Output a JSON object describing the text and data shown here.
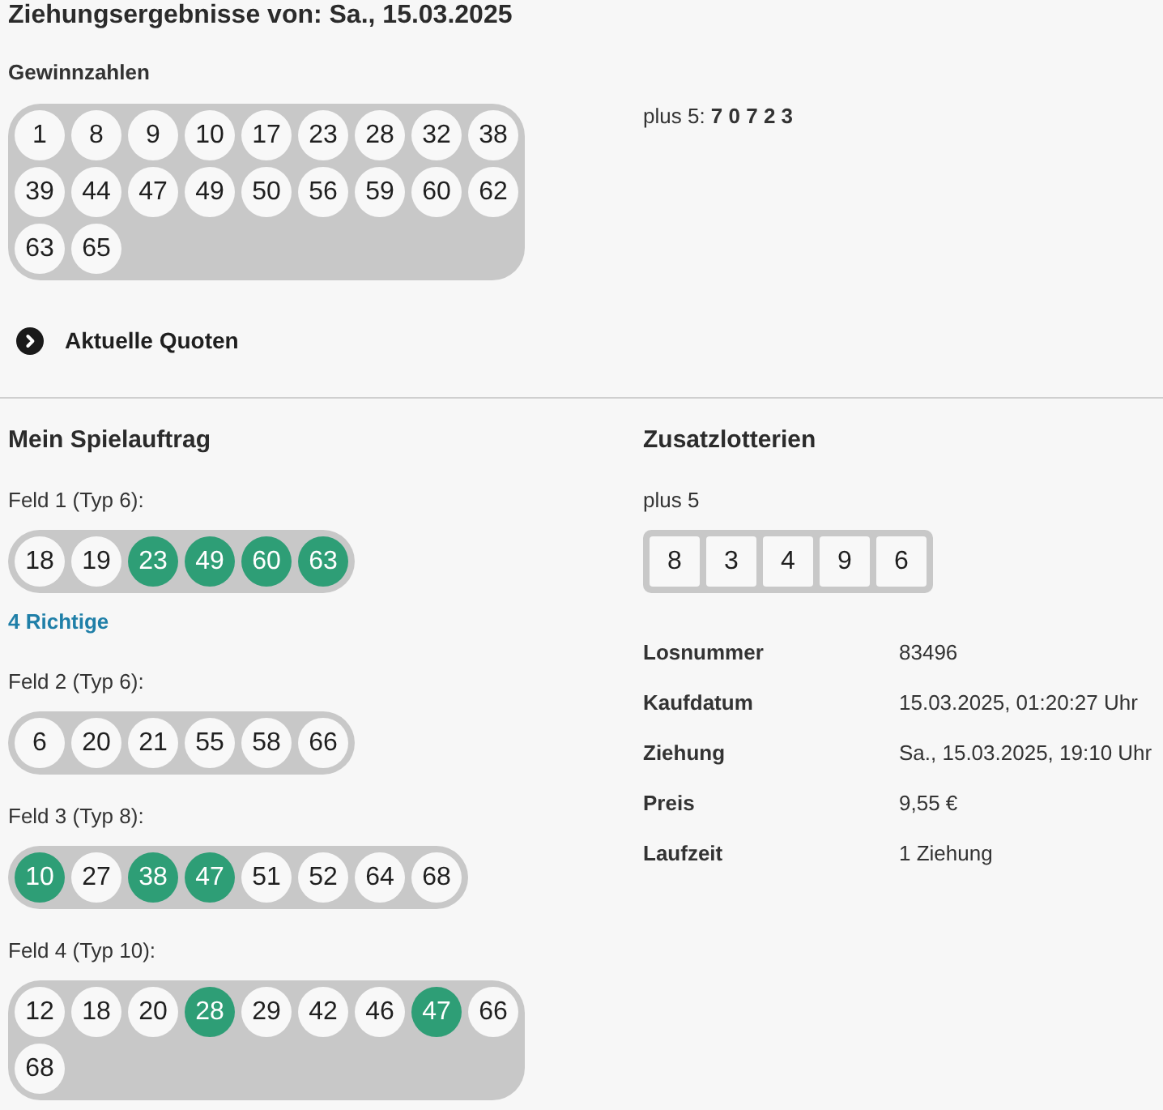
{
  "draw": {
    "title": "Ziehungsergebnisse von: Sa., 15.03.2025",
    "numbers_label": "Gewinnzahlen",
    "numbers": [
      "1",
      "8",
      "9",
      "10",
      "17",
      "23",
      "28",
      "32",
      "38",
      "39",
      "44",
      "47",
      "49",
      "50",
      "56",
      "59",
      "60",
      "62",
      "63",
      "65"
    ],
    "plus5_result": "plus 5: **7 0 7 2 3**"
  },
  "quotes_link": {
    "label": "Aktuelle Quoten",
    "expanded": false
  },
  "my_ticket": {
    "heading": "Mein Spielauftrag",
    "fields": [
      {
        "label": "Feld 1 (Typ 6):",
        "numbers": [
          {
            "value": "18",
            "hit": false
          },
          {
            "value": "19",
            "hit": false
          },
          {
            "value": "23",
            "hit": true
          },
          {
            "value": "49",
            "hit": true
          },
          {
            "value": "60",
            "hit": true
          },
          {
            "value": "63",
            "hit": true
          }
        ],
        "result": "4 Richtige"
      },
      {
        "label": "Feld 2 (Typ 6):",
        "numbers": [
          {
            "value": "6",
            "hit": false
          },
          {
            "value": "20",
            "hit": false
          },
          {
            "value": "21",
            "hit": false
          },
          {
            "value": "55",
            "hit": false
          },
          {
            "value": "58",
            "hit": false
          },
          {
            "value": "66",
            "hit": false
          }
        ]
      },
      {
        "label": "Feld 3 (Typ 8):",
        "numbers": [
          {
            "value": "10",
            "hit": true
          },
          {
            "value": "27",
            "hit": false
          },
          {
            "value": "38",
            "hit": true
          },
          {
            "value": "47",
            "hit": true
          },
          {
            "value": "51",
            "hit": false
          },
          {
            "value": "52",
            "hit": false
          },
          {
            "value": "64",
            "hit": false
          },
          {
            "value": "68",
            "hit": false
          }
        ]
      },
      {
        "label": "Feld 4 (Typ 10):",
        "numbers": [
          {
            "value": "12",
            "hit": false
          },
          {
            "value": "18",
            "hit": false
          },
          {
            "value": "20",
            "hit": false
          },
          {
            "value": "28",
            "hit": true
          },
          {
            "value": "29",
            "hit": false
          },
          {
            "value": "42",
            "hit": false
          },
          {
            "value": "46",
            "hit": false
          },
          {
            "value": "47",
            "hit": true
          },
          {
            "value": "66",
            "hit": false
          },
          {
            "value": "68",
            "hit": false
          }
        ]
      }
    ]
  },
  "extra_lotteries": {
    "heading": "Zusatzlotterien",
    "name": "plus 5",
    "digits": [
      "8",
      "3",
      "4",
      "9",
      "6"
    ]
  },
  "details": [
    {
      "label": "Losnummer",
      "value": "83496"
    },
    {
      "label": "Kaufdatum",
      "value": "15.03.2025, 01:20:27 Uhr"
    },
    {
      "label": "Ziehung",
      "value": "Sa., 15.03.2025, 19:10 Uhr"
    },
    {
      "label": "Preis",
      "value": "9,55 €"
    },
    {
      "label": "Laufzeit",
      "value": "1 Ziehung"
    }
  ]
}
